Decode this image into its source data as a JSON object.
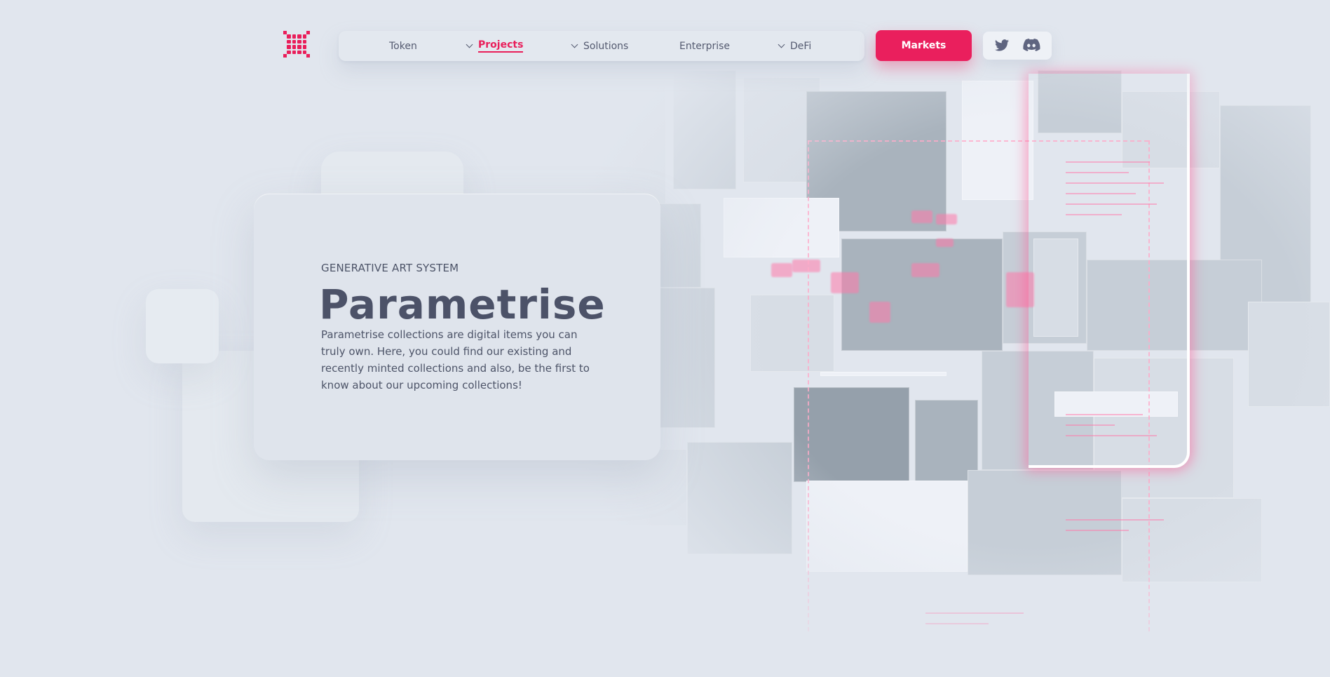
{
  "brand": {
    "logo_icon": "grid-logo-icon",
    "accent": "#e91e5a"
  },
  "nav": {
    "items": [
      {
        "label": "Token",
        "dropdown": false,
        "active": false
      },
      {
        "label": "Projects",
        "dropdown": true,
        "active": true
      },
      {
        "label": "Solutions",
        "dropdown": true,
        "active": false
      },
      {
        "label": "Enterprise",
        "dropdown": false,
        "active": false
      },
      {
        "label": "DeFi",
        "dropdown": true,
        "active": false
      }
    ]
  },
  "cta": {
    "markets_label": "Markets"
  },
  "social": {
    "icons": [
      "twitter-icon",
      "discord-icon"
    ]
  },
  "hero": {
    "kicker": "GENERATIVE ART SYSTEM",
    "title": "Parametrise",
    "description": "Parametrise collections are digital items you can truly own. Here, you could find our existing and recently minted collections and also, be the first to know about our upcoming collections!"
  }
}
